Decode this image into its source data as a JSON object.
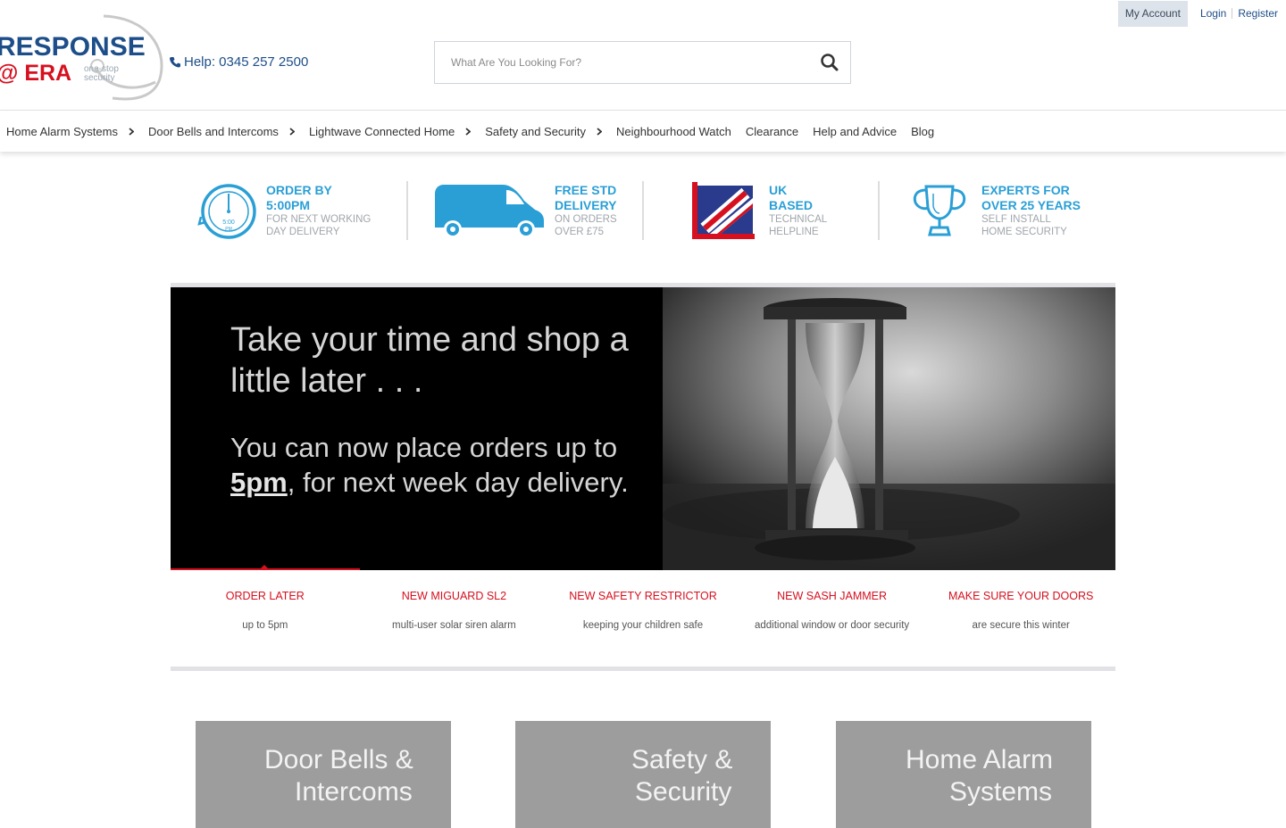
{
  "account": {
    "my_account": "My Account",
    "login": "Login",
    "register": "Register"
  },
  "header": {
    "logo": {
      "line1": "RESPONSE",
      "line2": "@ ERA",
      "tag1": "one-stop",
      "tag2": "security"
    },
    "help": "Help: 0345 257 2500",
    "search_placeholder": "What Are You Looking For?"
  },
  "nav": [
    {
      "label": "Home Alarm Systems",
      "has_submenu": true
    },
    {
      "label": "Door Bells and Intercoms",
      "has_submenu": true
    },
    {
      "label": "Lightwave Connected Home",
      "has_submenu": true
    },
    {
      "label": "Safety and Security",
      "has_submenu": true
    },
    {
      "label": "Neighbourhood Watch",
      "has_submenu": false
    },
    {
      "label": "Clearance",
      "has_submenu": false
    },
    {
      "label": "Help and Advice",
      "has_submenu": false
    },
    {
      "label": "Blog",
      "has_submenu": false
    }
  ],
  "usps": [
    {
      "icon": "clock-icon",
      "title1": "ORDER BY",
      "title2": "5:00PM",
      "text1": "FOR NEXT WORKING",
      "text2": "DAY DELIVERY",
      "icon_text1": "5:00",
      "icon_text2": "PM"
    },
    {
      "icon": "van-icon",
      "title1": "FREE STD",
      "title2": "DELIVERY",
      "text1": "ON ORDERS",
      "text2": "OVER £75"
    },
    {
      "icon": "uk-flag-icon",
      "title1": "UK",
      "title2": "BASED",
      "text1": "TECHNICAL",
      "text2": "HELPLINE"
    },
    {
      "icon": "trophy-icon",
      "title1": "EXPERTS FOR",
      "title2": "OVER 25 YEARS",
      "text1": "SELF INSTALL",
      "text2": "HOME SECURITY"
    }
  ],
  "banner": {
    "heading": "Take your time and shop a little later . . .",
    "body_before": "You can now place orders up to ",
    "body_highlight": "5pm",
    "body_after": ", for next week day delivery."
  },
  "slides": [
    {
      "title": "ORDER LATER",
      "subtitle": "up to 5pm"
    },
    {
      "title": "NEW MIGUARD SL2",
      "subtitle": "multi-user solar siren alarm"
    },
    {
      "title": "NEW SAFETY RESTRICTOR",
      "subtitle": "keeping your children safe"
    },
    {
      "title": "NEW SASH JAMMER",
      "subtitle": "additional window or door security"
    },
    {
      "title": "MAKE SURE YOUR DOORS",
      "subtitle": "are secure this winter"
    }
  ],
  "tiles": [
    {
      "line1": "Door Bells &",
      "line2": "Intercoms"
    },
    {
      "line1": "Safety &",
      "line2": "Security"
    },
    {
      "line1": "Home Alarm",
      "line2": "Systems"
    }
  ],
  "colors": {
    "brand_blue": "#1d4e89",
    "accent_red": "#d6101f",
    "usp_blue": "#2a9fd6",
    "tile_grey": "#9d9d9d"
  }
}
